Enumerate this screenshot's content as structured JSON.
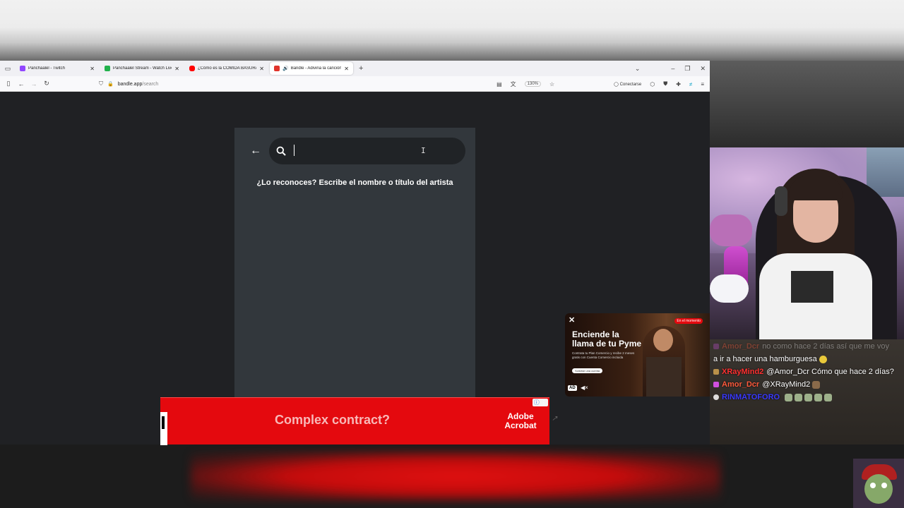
{
  "tabs": [
    {
      "title": "Panchaalel - Twitch",
      "favicon_color": "#9146ff",
      "active": false
    },
    {
      "title": "Panchaalel Stream - Watch Live",
      "favicon_color": "#22b14c",
      "active": false
    },
    {
      "title": "¿Cómo es la COMIDA BASURA...",
      "favicon_color": "#ff0000",
      "active": false
    },
    {
      "title": "Bandle - Adivina la canción",
      "favicon_color": "#e0332b",
      "active": true
    }
  ],
  "navbar": {
    "url_host": "bandle.app",
    "url_path": "/search",
    "zoom": "130%",
    "connect_label": "Conectarse"
  },
  "bandle": {
    "search_value": "",
    "prompt": "¿Lo reconoces? Escribe el nombre o título del artista"
  },
  "banner_ad": {
    "headline": "Complex contract?",
    "brand_line1": "Adobe",
    "brand_line2": "Acrobat"
  },
  "video_ad": {
    "title": "Enciende la llama de tu Pyme",
    "subtitle": "Contrata tu Plan Comercio y recibe 2 meses gratis con Cuenta Comercio incluida",
    "tag": "En el momento",
    "cta": "Solicitar una cuenta",
    "badge": "AD"
  },
  "chat": [
    {
      "user": "Amor_Dcr",
      "message": "no como hace 2 días así que me voy",
      "color": "#ff5a3c",
      "faded": true
    },
    {
      "user": "",
      "message": "a ir a hacer una hamburguesa",
      "color": "#ffffff",
      "faded": false
    },
    {
      "user": "XRayMind2",
      "message": "@Amor_Dcr Cómo que hace 2 días?",
      "color": "#ff3030",
      "faded": false
    },
    {
      "user": "Amor_Dcr",
      "message": "@XRayMind2",
      "color": "#ff5a3c",
      "faded": false
    },
    {
      "user": "RINMATOFORO",
      "message": "",
      "color": "#3a3aff",
      "faded": false
    }
  ]
}
